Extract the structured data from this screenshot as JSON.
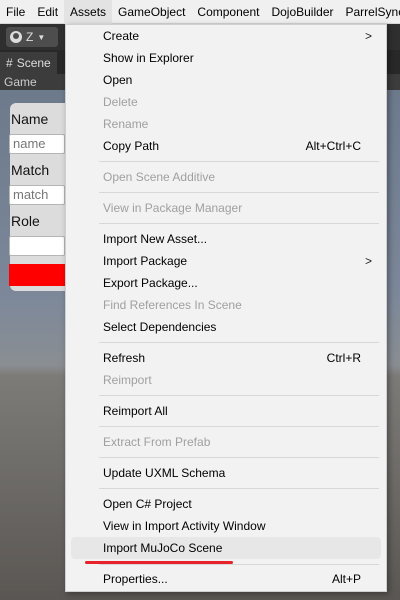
{
  "menubar": {
    "items": [
      "File",
      "Edit",
      "Assets",
      "GameObject",
      "Component",
      "DojoBuilder",
      "ParrelSync"
    ]
  },
  "toolbar": {
    "account_label": "Z"
  },
  "scene_tab": {
    "label": "Scene"
  },
  "game_tab": {
    "label": "Game"
  },
  "panel": {
    "name_label": "Name",
    "name_placeholder": "name",
    "match_label": "Match",
    "match_placeholder": "match",
    "role_label": "Role"
  },
  "context_menu": {
    "create": "Create",
    "show_in_explorer": "Show in Explorer",
    "open": "Open",
    "delete": "Delete",
    "rename": "Rename",
    "copy_path": "Copy Path",
    "copy_path_shortcut": "Alt+Ctrl+C",
    "open_scene_additive": "Open Scene Additive",
    "view_in_package_manager": "View in Package Manager",
    "import_new_asset": "Import New Asset...",
    "import_package": "Import Package",
    "export_package": "Export Package...",
    "find_references": "Find References In Scene",
    "select_dependencies": "Select Dependencies",
    "refresh": "Refresh",
    "refresh_shortcut": "Ctrl+R",
    "reimport": "Reimport",
    "reimport_all": "Reimport All",
    "extract_from_prefab": "Extract From Prefab",
    "update_uxml_schema": "Update UXML Schema",
    "open_csharp_project": "Open C# Project",
    "view_import_activity": "View in Import Activity Window",
    "import_mujoco_scene": "Import MuJoCo Scene",
    "properties": "Properties...",
    "properties_shortcut": "Alt+P",
    "submenu_arrow": ">"
  },
  "colors": {
    "accent_red": "#ff0000",
    "underline_red": "#e8222a"
  }
}
